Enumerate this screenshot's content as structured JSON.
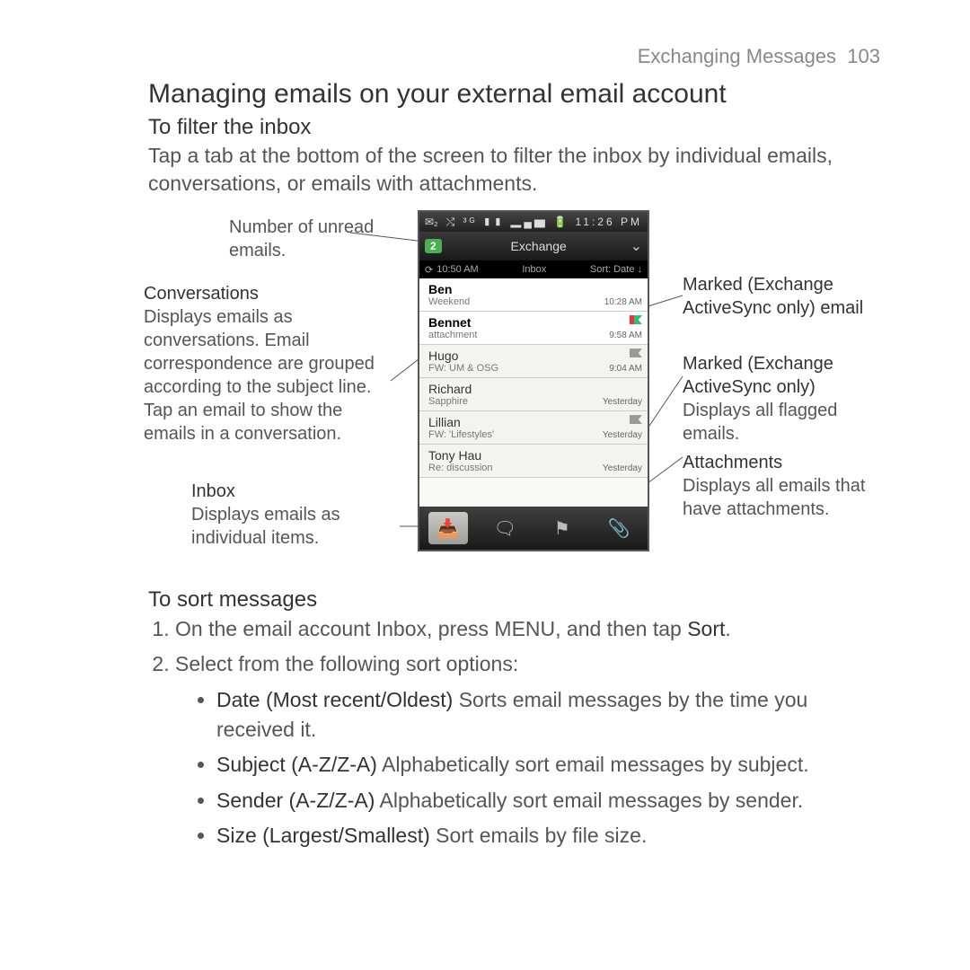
{
  "header": {
    "chapter": "Exchanging Messages",
    "page": "103"
  },
  "titles": {
    "h1": "Managing emails on your external email account",
    "h2a": "To filter the inbox",
    "h2b": "To sort messages"
  },
  "intro": "Tap a tab at the bottom of the screen to filter the inbox by individual emails, conversations, or emails with attachments.",
  "callouts": {
    "unread": "Number of unread emails.",
    "conv_head": "Conversations",
    "conv_body": "Displays emails as conversations. Email correspondence are grouped according to the subject line. Tap an email to show the emails in a conversation.",
    "inbox_head": "Inbox",
    "inbox_body": "Displays emails as individual items.",
    "marked1": "Marked (Exchange ActiveSync only) email",
    "marked2_head": "Marked (Exchange ActiveSync only)",
    "marked2_body": "Displays all flagged emails.",
    "attach_head": "Attachments",
    "attach_body": "Displays all emails that have attachments."
  },
  "phone": {
    "status_time": "11:26 PM",
    "status_icons": "⤭ ³ᴳ ▮▮ ▂▄▆ 🔋",
    "sb_left": "✉₂",
    "unread_count": "2",
    "account": "Exchange",
    "refresh_time": "10:50 AM",
    "folder": "Inbox",
    "sort": "Sort: Date ↓",
    "rows": [
      {
        "name": "Ben",
        "subj": "Weekend",
        "time": "10:28 AM",
        "flag": "",
        "unread": true
      },
      {
        "name": "Bennet",
        "subj": "attachment",
        "time": "9:58 AM",
        "flag": "multi",
        "unread": true
      },
      {
        "name": "Hugo",
        "subj": "FW: UM & OSG",
        "time": "9:04 AM",
        "flag": "grey",
        "unread": false
      },
      {
        "name": "Richard",
        "subj": "Sapphire",
        "time": "Yesterday",
        "flag": "",
        "unread": false
      },
      {
        "name": "Lillian",
        "subj": "FW: 'Lifestyles'",
        "time": "Yesterday",
        "flag": "grey",
        "unread": false
      },
      {
        "name": "Tony Hau",
        "subj": "Re: discussion",
        "time": "Yesterday",
        "flag": "",
        "unread": false
      }
    ],
    "tabs": {
      "inbox": "📥",
      "conv": "🗨",
      "marked": "⚑",
      "attach": "📎"
    }
  },
  "steps": {
    "s1a": "On the email account Inbox, press MENU, and then tap ",
    "s1b": "Sort",
    "s1c": ".",
    "s2": "Select from the following sort options:",
    "opts": [
      {
        "kw": "Date (Most recent/Oldest)",
        "rest": "  Sorts email messages by the time you received it."
      },
      {
        "kw": "Subject (A-Z/Z-A)",
        "rest": "  Alphabetically sort email messages by subject."
      },
      {
        "kw": "Sender (A-Z/Z-A)",
        "rest": "  Alphabetically sort email messages by sender."
      },
      {
        "kw": "Size (Largest/Smallest)",
        "rest": "  Sort emails by file size."
      }
    ]
  }
}
